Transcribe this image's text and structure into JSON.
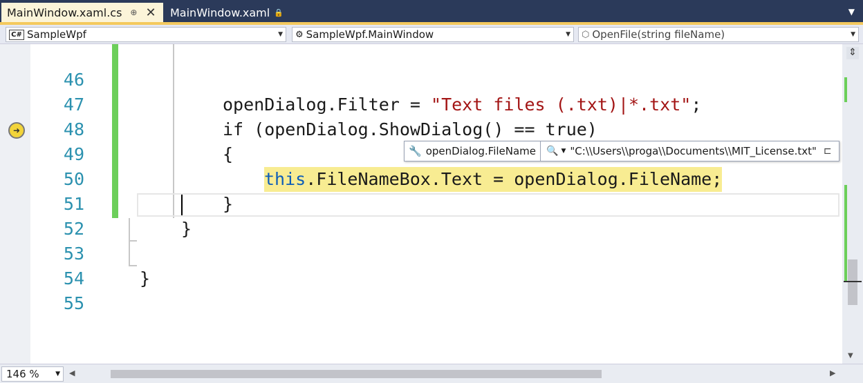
{
  "tabs": [
    {
      "label": "MainWindow.xaml.cs",
      "pin": "⊕",
      "close": "✕"
    },
    {
      "label": "MainWindow.xaml",
      "lock": "🔒"
    }
  ],
  "tab_overflow": "▼",
  "navbar": {
    "project": "SampleWpf",
    "type": "SampleWpf.MainWindow",
    "member": "OpenFile(string fileName)",
    "cs_icon": "C#"
  },
  "code_lines": [
    {
      "num": "46"
    },
    {
      "num": "47"
    },
    {
      "num": "48"
    },
    {
      "num": "49"
    },
    {
      "num": "50"
    },
    {
      "num": "51"
    },
    {
      "num": "52"
    },
    {
      "num": "53"
    },
    {
      "num": "54"
    },
    {
      "num": "55"
    }
  ],
  "code": {
    "l46_a": "openDialog.Filter = ",
    "l46_str": "\"Text files (.txt)|*.txt\"",
    "l46_end": ";",
    "l47": "if (openDialog.ShowDialog() == true)",
    "l48": "{",
    "l49_this": "this",
    "l49_rest": ".FileNameBox.Text = openDialog.FileName;",
    "l50": "}",
    "l51": "}",
    "l53": "}"
  },
  "datatip": {
    "expression": "openDialog.FileName",
    "value": "\"C:\\\\Users\\\\proga\\\\Documents\\\\MIT_License.txt\""
  },
  "zoom": "146 %",
  "colors": {
    "accent_tab": "#fbf4d9",
    "tab_strip": "#2b3a5a",
    "change_bar": "#6ccf5a",
    "highlight": "#f8ec92",
    "line_number": "#2b91af"
  }
}
